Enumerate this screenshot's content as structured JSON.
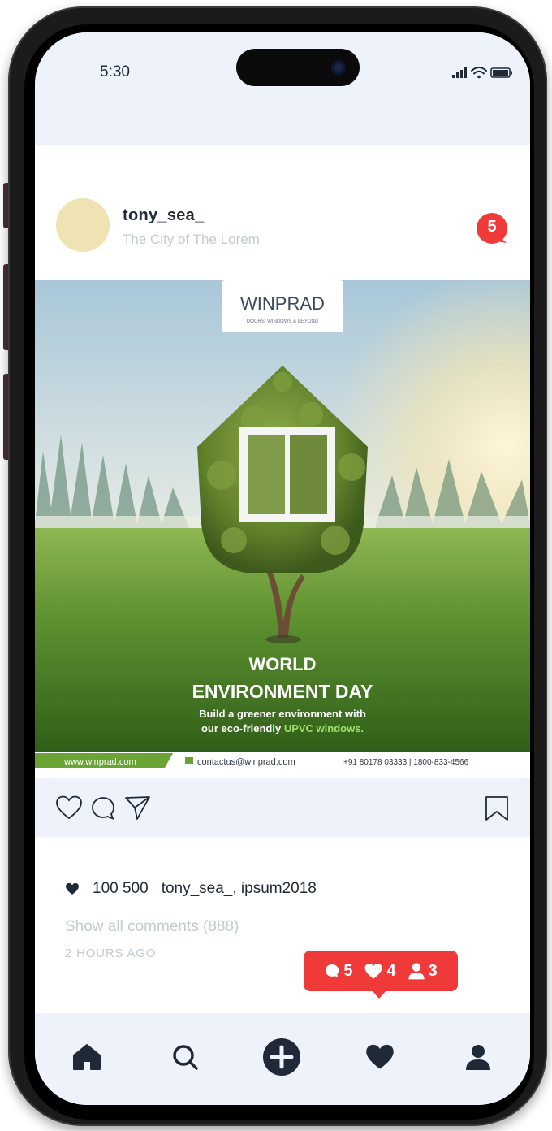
{
  "status_bar": {
    "time": "5:30",
    "icons": [
      "signal-icon",
      "wifi-icon",
      "battery-icon"
    ]
  },
  "post": {
    "username": "tony_sea_",
    "location": "The City of The Lorem",
    "message_badge_count": "5",
    "image": {
      "brand": "WINPRAD",
      "brand_tagline": "DOORS, WINDOWS & BEYOND",
      "headline_line1": "WORLD",
      "headline_line2": "ENVIRONMENT DAY",
      "subline1": "Build a greener environment with",
      "subline2_prefix": "our eco-friendly ",
      "subline2_highlight": "UPVC windows.",
      "website": "www.winprad.com",
      "email": "contactus@winprad.com",
      "phone": "+91 80178 03333 | 1800-833-4566"
    },
    "likes_count": "100 500",
    "liked_by": "tony_sea_, ipsum2018",
    "show_comments": "Show all comments (888)",
    "time_ago": "2 HOURS AGO"
  },
  "notifications": {
    "comments": "5",
    "likes": "4",
    "followers": "3"
  },
  "colors": {
    "accent": "#f03a3a",
    "background": "#eef3fb",
    "text": "#1f2937",
    "muted": "#c4cad3",
    "brand_green": "#6aa434"
  }
}
